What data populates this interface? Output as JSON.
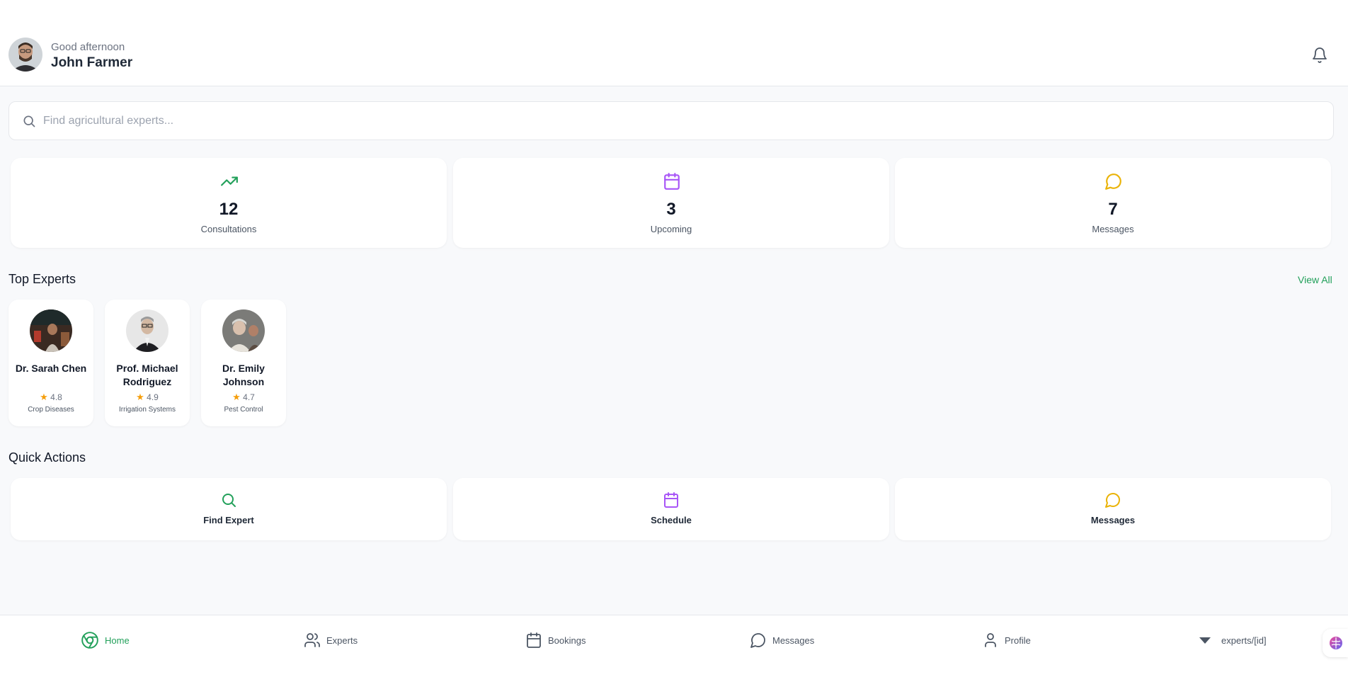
{
  "header": {
    "greeting": "Good afternoon",
    "user_name": "John Farmer"
  },
  "search": {
    "placeholder": "Find agricultural experts..."
  },
  "stats": [
    {
      "icon": "trending-up-icon",
      "value": "12",
      "label": "Consultations",
      "color": "#22a05a"
    },
    {
      "icon": "calendar-icon",
      "value": "3",
      "label": "Upcoming",
      "color": "#a855f7"
    },
    {
      "icon": "message-circle-icon",
      "value": "7",
      "label": "Messages",
      "color": "#eab308"
    }
  ],
  "top_experts": {
    "title": "Top Experts",
    "view_all": "View All",
    "experts": [
      {
        "name": "Dr. Sarah Chen",
        "rating": "4.8",
        "specialty": "Crop Diseases"
      },
      {
        "name": "Prof. Michael Rodriguez",
        "rating": "4.9",
        "specialty": "Irrigation Systems"
      },
      {
        "name": "Dr. Emily Johnson",
        "rating": "4.7",
        "specialty": "Pest Control"
      }
    ]
  },
  "quick_actions": {
    "title": "Quick Actions",
    "actions": [
      {
        "icon": "search-icon",
        "label": "Find Expert",
        "color": "#22a05a"
      },
      {
        "icon": "calendar-icon",
        "label": "Schedule",
        "color": "#a855f7"
      },
      {
        "icon": "message-circle-icon",
        "label": "Messages",
        "color": "#eab308"
      }
    ]
  },
  "nav": {
    "items": [
      {
        "icon": "chrome-icon",
        "label": "Home",
        "active": true
      },
      {
        "icon": "users-icon",
        "label": "Experts"
      },
      {
        "icon": "calendar-icon",
        "label": "Bookings"
      },
      {
        "icon": "message-circle-icon",
        "label": "Messages"
      },
      {
        "icon": "user-icon",
        "label": "Profile"
      },
      {
        "icon": "chevron-down-icon",
        "label": "experts/[id]"
      }
    ]
  },
  "colors": {
    "accent": "#22a05a",
    "purple": "#a855f7",
    "amber": "#eab308"
  }
}
